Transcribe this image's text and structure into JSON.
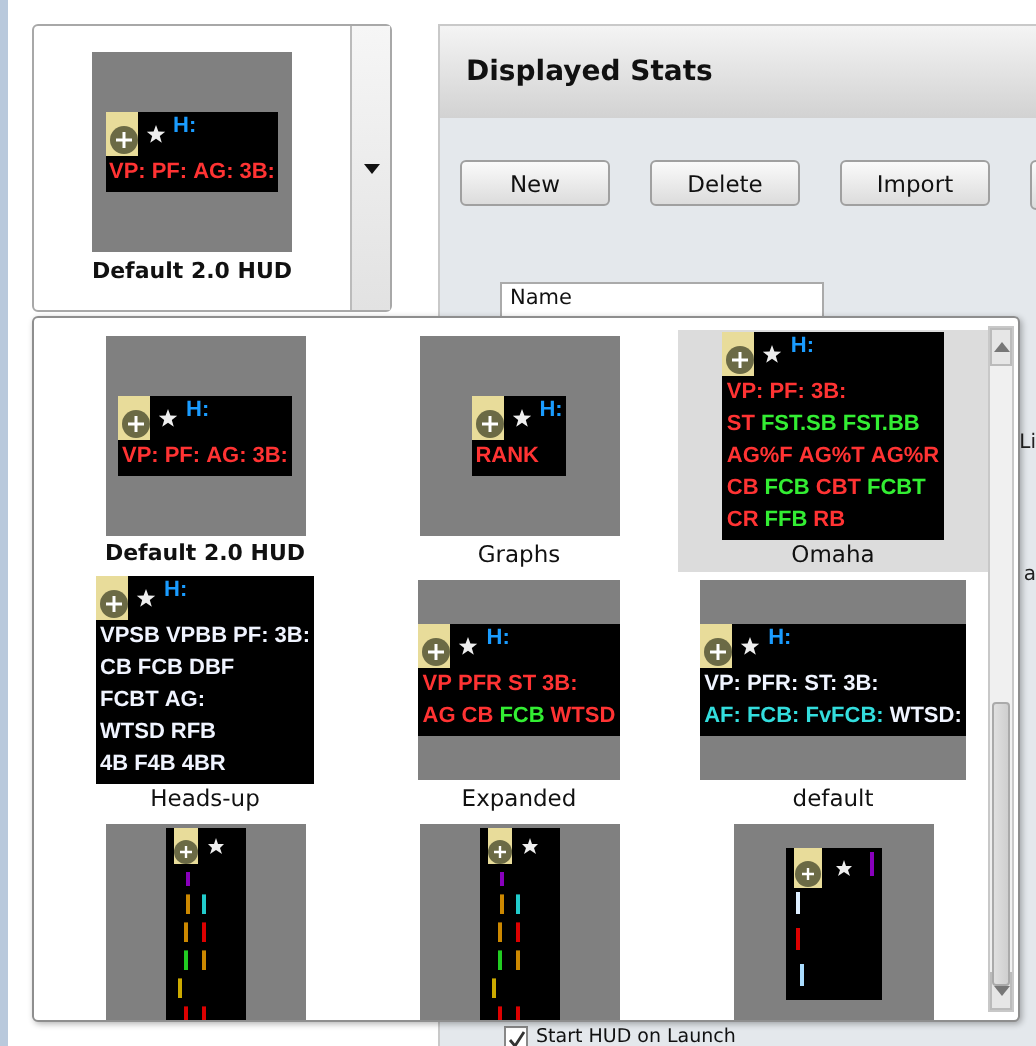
{
  "current_hud": {
    "name": "Default 2.0 HUD",
    "preview": {
      "kind": "panel",
      "header": "H:",
      "lines": [
        [
          {
            "t": "VP:",
            "color": "#ff3333"
          },
          {
            "t": "PF:",
            "color": "#ff3333"
          },
          {
            "t": "AG:",
            "color": "#ff3333"
          },
          {
            "t": "3B:",
            "color": "#ff3333"
          }
        ]
      ]
    }
  },
  "panel": {
    "title": "Displayed Stats",
    "buttons": [
      "New",
      "Delete",
      "Import"
    ],
    "name_field": {
      "value": "Name"
    },
    "side_fragments": [
      "Li",
      "a"
    ],
    "start_checkbox": {
      "label": "Start HUD on Launch",
      "checked": true
    }
  },
  "hud_list": [
    {
      "name": "Default 2.0 HUD",
      "selected": false,
      "preview": {
        "kind": "panel",
        "header": "H:",
        "lines": [
          [
            {
              "t": "VP:",
              "color": "#ff3333"
            },
            {
              "t": "PF:",
              "color": "#ff3333"
            },
            {
              "t": "AG:",
              "color": "#ff3333"
            },
            {
              "t": "3B:",
              "color": "#ff3333"
            }
          ]
        ]
      }
    },
    {
      "name": "Graphs",
      "selected": false,
      "preview": {
        "kind": "panel",
        "header": "H:",
        "lines": [
          [
            {
              "t": "RANK",
              "color": "#ff3333"
            }
          ]
        ]
      }
    },
    {
      "name": "Omaha",
      "selected": true,
      "preview": {
        "kind": "panel",
        "header": "H:",
        "lines": [
          [
            {
              "t": "VP:",
              "color": "#ff3333"
            },
            {
              "t": "PF:",
              "color": "#ff3333"
            },
            {
              "t": "3B:",
              "color": "#ff3333"
            }
          ],
          [
            {
              "t": "ST",
              "color": "#ff3333"
            },
            {
              "t": "FST.SB",
              "color": "#33ee33"
            },
            {
              "t": "FST.BB",
              "color": "#33ee33"
            }
          ],
          [
            {
              "t": "AG%F",
              "color": "#ff3333"
            },
            {
              "t": "AG%T",
              "color": "#ff3333"
            },
            {
              "t": "AG%R",
              "color": "#ff3333"
            }
          ],
          [
            {
              "t": "CB",
              "color": "#ff3333"
            },
            {
              "t": "FCB",
              "color": "#33ee33"
            },
            {
              "t": "CBT",
              "color": "#ff3333"
            },
            {
              "t": "FCBT",
              "color": "#33ee33"
            }
          ],
          [
            {
              "t": "CR",
              "color": "#ff3333"
            },
            {
              "t": "FFB",
              "color": "#33ee33"
            },
            {
              "t": "RB",
              "color": "#ff3333"
            }
          ]
        ]
      }
    },
    {
      "name": "Heads-up",
      "selected": false,
      "preview": {
        "kind": "panel",
        "header": "H:",
        "lines": [
          [
            {
              "t": "VPSB",
              "color": "#f0f4ff"
            },
            {
              "t": "VPBB",
              "color": "#f0f4ff"
            },
            {
              "t": "PF:",
              "color": "#f0f4ff"
            },
            {
              "t": "3B:",
              "color": "#f0f4ff"
            }
          ],
          [
            {
              "t": "CB",
              "color": "#f0f4ff"
            },
            {
              "t": "FCB",
              "color": "#f0f4ff"
            },
            {
              "t": "DBF",
              "color": "#f0f4ff"
            }
          ],
          [
            {
              "t": "FCBT",
              "color": "#f0f4ff"
            },
            {
              "t": "AG:",
              "color": "#f0f4ff"
            }
          ],
          [
            {
              "t": "WTSD",
              "color": "#f0f4ff"
            },
            {
              "t": "RFB",
              "color": "#f0f4ff"
            }
          ],
          [
            {
              "t": "4B",
              "color": "#f0f4ff"
            },
            {
              "t": "F4B",
              "color": "#f0f4ff"
            },
            {
              "t": "4BR",
              "color": "#f0f4ff"
            }
          ]
        ]
      }
    },
    {
      "name": "Expanded",
      "selected": false,
      "preview": {
        "kind": "panel",
        "header": "H:",
        "lines": [
          [
            {
              "t": "VP",
              "color": "#ff3333"
            },
            {
              "t": "PFR",
              "color": "#ff3333"
            },
            {
              "t": "ST",
              "color": "#ff3333"
            },
            {
              "t": "3B:",
              "color": "#ff3333"
            }
          ],
          [
            {
              "t": "AG",
              "color": "#ff3333"
            },
            {
              "t": "CB",
              "color": "#ff3333"
            },
            {
              "t": "FCB",
              "color": "#33ee33"
            },
            {
              "t": "WTSD",
              "color": "#ff3333"
            }
          ]
        ]
      }
    },
    {
      "name": "default",
      "selected": false,
      "preview": {
        "kind": "panel",
        "header": "H:",
        "lines": [
          [
            {
              "t": "VP:",
              "color": "#f0f4ff"
            },
            {
              "t": "PFR:",
              "color": "#f0f4ff"
            },
            {
              "t": "ST:",
              "color": "#f0f4ff"
            },
            {
              "t": "3B:",
              "color": "#f0f4ff"
            }
          ],
          [
            {
              "t": "AF:",
              "color": "#33dddd"
            },
            {
              "t": "FCB:",
              "color": "#33dddd"
            },
            {
              "t": "FvFCB:",
              "color": "#33dddd"
            },
            {
              "t": "WTSD:",
              "color": "#f0f4ff"
            }
          ]
        ]
      }
    },
    {
      "selected": false,
      "preview": {
        "kind": "strip"
      }
    },
    {
      "selected": false,
      "preview": {
        "kind": "strip"
      }
    },
    {
      "selected": false,
      "preview": {
        "kind": "box"
      }
    }
  ]
}
